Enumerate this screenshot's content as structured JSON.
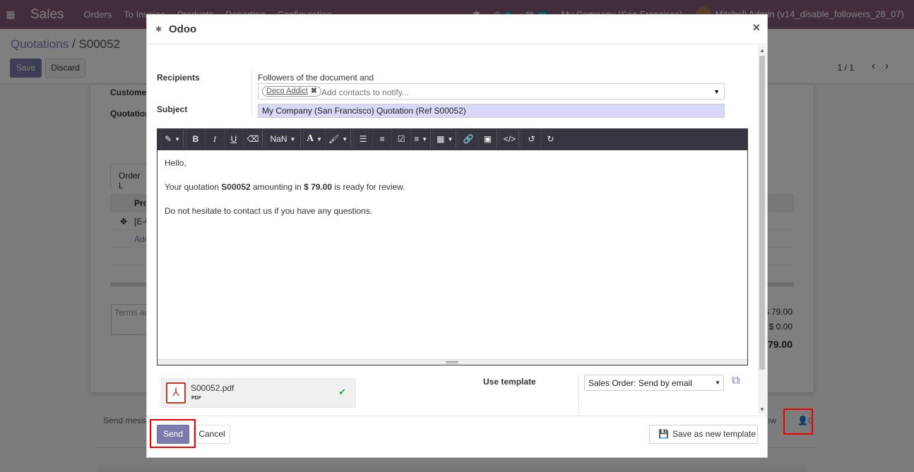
{
  "app": {
    "name": "Sales",
    "menu": [
      "Orders",
      "To Invoice",
      "Products",
      "Reporting",
      "Configuration"
    ],
    "activity_count": "5",
    "message_count": "69",
    "company": "My Company (San Francisco)",
    "user": "Mitchell Admin (v14_disable_followers_28_07)"
  },
  "control_panel": {
    "breadcrumb_parent": "Quotations",
    "breadcrumb_separator": "/",
    "breadcrumb_current": "S00052",
    "save_label": "Save",
    "discard_label": "Discard",
    "pager": "1 / 1"
  },
  "form": {
    "customer_label": "Custome",
    "quotation_label": "Quotation",
    "tab_label": "Order L",
    "col_product": "Pro",
    "row_text": "[E-C",
    "add_line": "Add",
    "terms_placeholder": "Terms ar",
    "untaxed": "$ 79.00",
    "taxes": "$ 0.00",
    "total": "79.00"
  },
  "chatter": {
    "send_message": "Send messa",
    "follow": "ow",
    "followers_count": "0"
  },
  "dialog": {
    "title": "Odoo",
    "close": "×",
    "recipients_label": "Recipients",
    "followers_text": "Followers of the document and",
    "recipient_tag": "Deco Addict",
    "recipients_placeholder": "Add contacts to notify...",
    "subject_label": "Subject",
    "subject_value": "My Company (San Francisco) Quotation (Ref S00052)",
    "toolbar": {
      "font_size": "NaN"
    },
    "body": {
      "greeting": "Hello,",
      "line1_pre": "Your quotation ",
      "line1_ref": "S00052",
      "line1_mid": " amounting in ",
      "line1_amount": "$ 79.00",
      "line1_post": " is ready for review.",
      "line2": "Do not hesitate to contact us if you have any questions."
    },
    "attachment": {
      "name": "S00052.pdf",
      "ext": "PDF"
    },
    "use_template_label": "Use template",
    "template_value": "Sales Order: Send by email",
    "send_label": "Send",
    "cancel_label": "Cancel",
    "save_template_label": "Save as new template"
  },
  "colors": {
    "brand": "#875a7b",
    "primary": "#7c7bad",
    "highlight": "#e00000"
  }
}
